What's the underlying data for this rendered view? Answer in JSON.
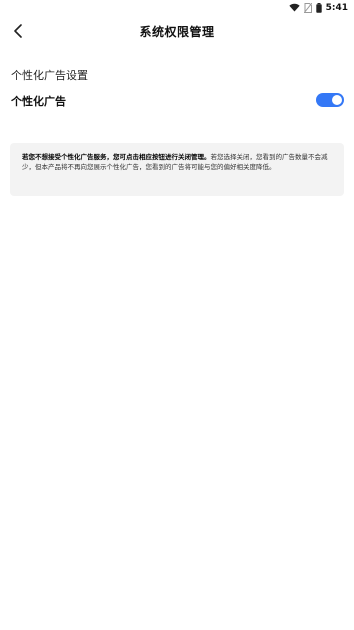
{
  "status_bar": {
    "time": "5:41",
    "icons": [
      "wifi-icon",
      "sim-off-icon",
      "battery-icon"
    ]
  },
  "header": {
    "title": "系统权限管理",
    "back_icon": "chevron-left-icon"
  },
  "section": {
    "title": "个性化广告设置"
  },
  "setting": {
    "label": "个性化广告",
    "enabled": true,
    "accent": "#3478f6"
  },
  "notice": {
    "text_highlight": "若您不想接受个性化广告服务，您可点击相应按钮进行关闭管理。",
    "text_rest": "若您选择关闭，您看到的广告数量不会减少，但本产品将不再向您展示个性化广告，您看到的广告将可能与您的偏好相关度降低。"
  }
}
